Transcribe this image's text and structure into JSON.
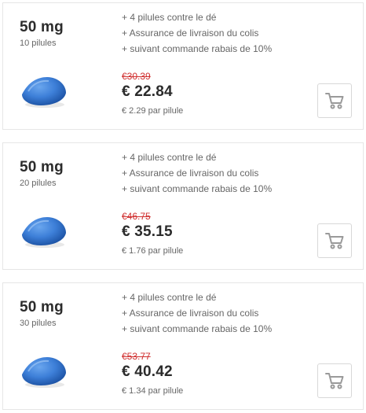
{
  "offers": [
    {
      "dosage": "50 mg",
      "count": "10 pilules",
      "features": [
        "+ 4 pilules contre le dé",
        "+ Assurance de livraison du colis",
        "+ suivant commande rabais de 10%"
      ],
      "old_price": "€30.39",
      "price": "€ 22.84",
      "unit_price": "€ 2.29 par pilule"
    },
    {
      "dosage": "50 mg",
      "count": "20 pilules",
      "features": [
        "+ 4 pilules contre le dé",
        "+ Assurance de livraison du colis",
        "+ suivant commande rabais de 10%"
      ],
      "old_price": "€46.75",
      "price": "€ 35.15",
      "unit_price": "€ 1.76 par pilule"
    },
    {
      "dosage": "50 mg",
      "count": "30 pilules",
      "features": [
        "+ 4 pilules contre le dé",
        "+ Assurance de livraison du colis",
        "+ suivant commande rabais de 10%"
      ],
      "old_price": "€53.77",
      "price": "€ 40.42",
      "unit_price": "€ 1.34 par pilule"
    }
  ],
  "icons": {
    "cart": "shopping-cart-icon",
    "pill": "pill-icon"
  },
  "colors": {
    "old_price": "#d03030",
    "pill_blue": "#3d7fd8",
    "cart_gray": "#9a9a9a",
    "card_border": "#e6e6e6"
  }
}
